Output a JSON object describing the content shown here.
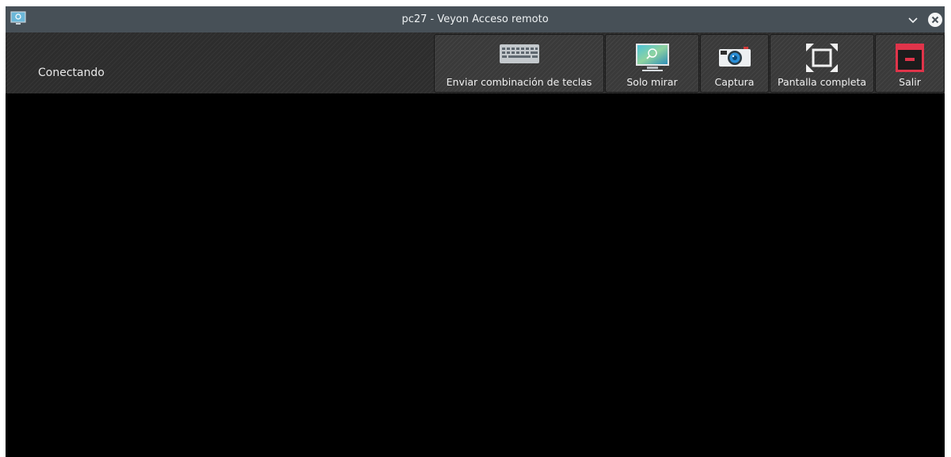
{
  "window": {
    "title": "pc27 - Veyon Acceso remoto"
  },
  "status": {
    "text": "Conectando"
  },
  "toolbar": {
    "buttons": [
      {
        "label": "Enviar combinación de teclas",
        "icon": "keyboard-icon"
      },
      {
        "label": "Solo mirar",
        "icon": "monitor-view-icon"
      },
      {
        "label": "Captura",
        "icon": "camera-icon"
      },
      {
        "label": "Pantalla completa",
        "icon": "fullscreen-icon"
      },
      {
        "label": "Salir",
        "icon": "exit-icon"
      }
    ]
  },
  "colors": {
    "titlebar": "#475057",
    "toolbar": "#2d2d2d",
    "remote_view": "#000000",
    "exit_accent": "#e0344a"
  }
}
